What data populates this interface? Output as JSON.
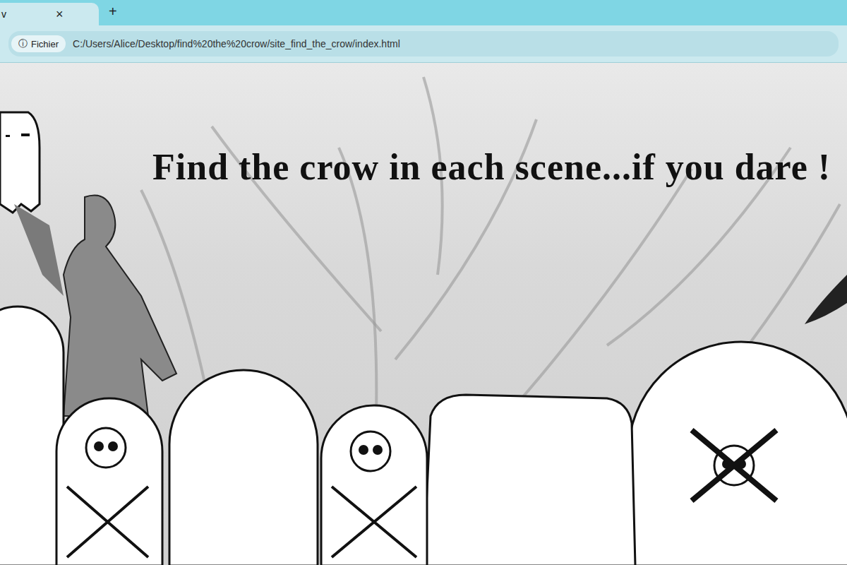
{
  "tabs": [
    {
      "label": "v",
      "selected": true
    }
  ],
  "tab_close": "×",
  "new_tab": "+",
  "address_bar": {
    "info_icon": "ⓘ",
    "badge": "Fichier",
    "url": "C:/Users/Alice/Desktop/find%20the%20crow/site_find_the_crow/index.html"
  },
  "page": {
    "title": "Find the crow in each scene...if you dare !"
  }
}
